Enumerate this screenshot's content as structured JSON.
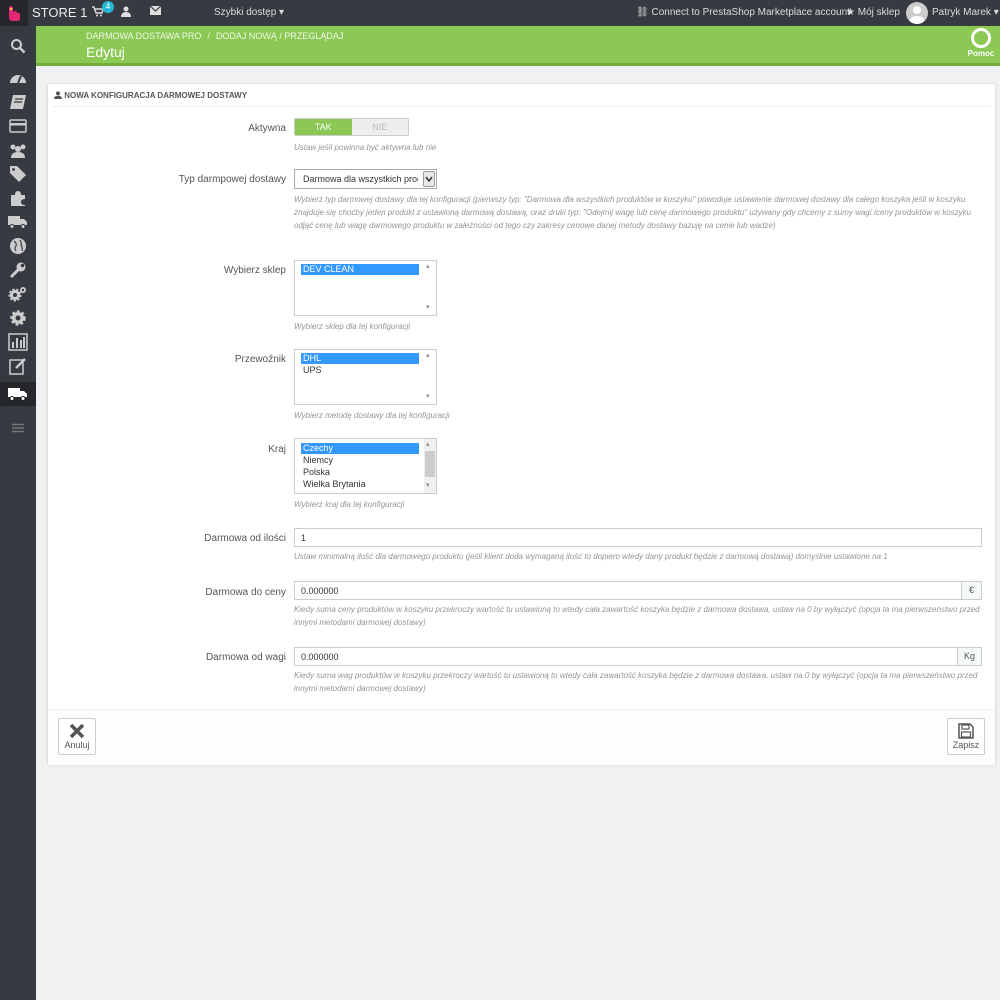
{
  "topbar": {
    "store_name": "STORE 1",
    "cart_badge": "4",
    "quick_access": "Szybki dostęp",
    "connect": "Connect to PrestaShop Marketplace account",
    "my_shop": "Mój sklep",
    "user_name": "Patryk Marek"
  },
  "sidebar": {
    "items": [
      "search-icon",
      "dashboard-icon",
      "book-icon",
      "credit-card-icon",
      "users-icon",
      "tags-icon",
      "puzzle-icon",
      "truck-icon",
      "globe-icon",
      "wrench-icon",
      "gears-icon",
      "gear-icon",
      "chart-icon",
      "edit-icon",
      "truck-icon",
      "menu-icon"
    ],
    "active_index": 14
  },
  "header": {
    "breadcrumb": [
      "DARMOWA DOSTAWA PRO",
      "DODAJ NOWĄ / PRZEGLĄDAJ"
    ],
    "title": "Edytuj",
    "help": "Pomoc"
  },
  "panel": {
    "heading": "NOWA KONFIGURACJA DARMOWEJ DOSTAWY",
    "active": {
      "label": "Aktywna",
      "yes": "TAK",
      "no": "NIE",
      "value": "TAK",
      "help": "Ustaw jeśli powinna być aktywna lub nie"
    },
    "type": {
      "label": "Typ darmpowej dostawy",
      "value": "Darmowa dla wszystkich produktów w koszyku",
      "help": "Wybierz typ darmowej dostawy dla tej konfiguracji (pierwszy typ: \"Darmowa dla wszystkich produktów w koszyku\" powoduje ustawienie darmowej dostawy dla całego koszyka jeśli w koszyku znajduje się choćby jeden produkt z ustawioną darmową dostawą, oraz druki typ: \"Odejmij wagę lub cenę darmowego produktu\" używany gdy chcemy z sumy wagi /ceny produktów w koszyku odjąć cenę lub wagę darmowego produktu w zależności od tego czy zakresy cenowe danej metody dostawy bazuję na cenie lub wadze)"
    },
    "shop": {
      "label": "Wybierz sklep",
      "options": [
        "DEV CLEAN"
      ],
      "selected": 0,
      "help": "Wybierz sklep dla tej konfiguracji"
    },
    "carrier": {
      "label": "Przewoźnik",
      "options": [
        "DHL",
        "UPS"
      ],
      "selected": 0,
      "help": "Wybierz metodę dostawy dla tej konfiguracji"
    },
    "country": {
      "label": "Kraj",
      "options": [
        "Czechy",
        "Niemcy",
        "Polska",
        "Wielka Brytania"
      ],
      "selected": 0,
      "help": "Wybierz kraj dla tej konfiguracji"
    },
    "min_qty": {
      "label": "Darmowa od ilości",
      "value": "1",
      "help": "Ustaw minimalną ilość dla darmowego produktu (jeśli klient doda wymaganą ilość to dopiero wtedy dany produkt będzie z darmową dostawą) domyślnie ustawione na 1"
    },
    "price": {
      "label": "Darmowa do ceny",
      "value": "0.000000",
      "unit": "€",
      "help": "Kiedy suma ceny produktów w koszyku przekroczy wartość tu ustawioną to wtedy cała zawartość koszyka będzie z darmowa dostawa, ustaw na 0 by wyłączyć (opcja ta ma pierwszeństwo przed innymi metodami darmowej dostawy)"
    },
    "weight": {
      "label": "Darmowa od wagi",
      "value": "0.000000",
      "unit": "Kg",
      "help": "Kiedy suma wag produktów w koszyku przekroczy wartość tu ustawioną to wtedy cała zawartość koszyka będzie z darmowa dostawa, ustaw na 0 by wyłączyć (opcja ta ma pierwszeństwo przed innymi metodami darmowej dostawy)"
    },
    "cancel": "Anuluj",
    "save": "Zapisz"
  },
  "colors": {
    "header_green": "#8bc954",
    "sidebar_dark": "#363a41",
    "select_blue": "#3399ff",
    "badge_blue": "#25b9d7"
  }
}
